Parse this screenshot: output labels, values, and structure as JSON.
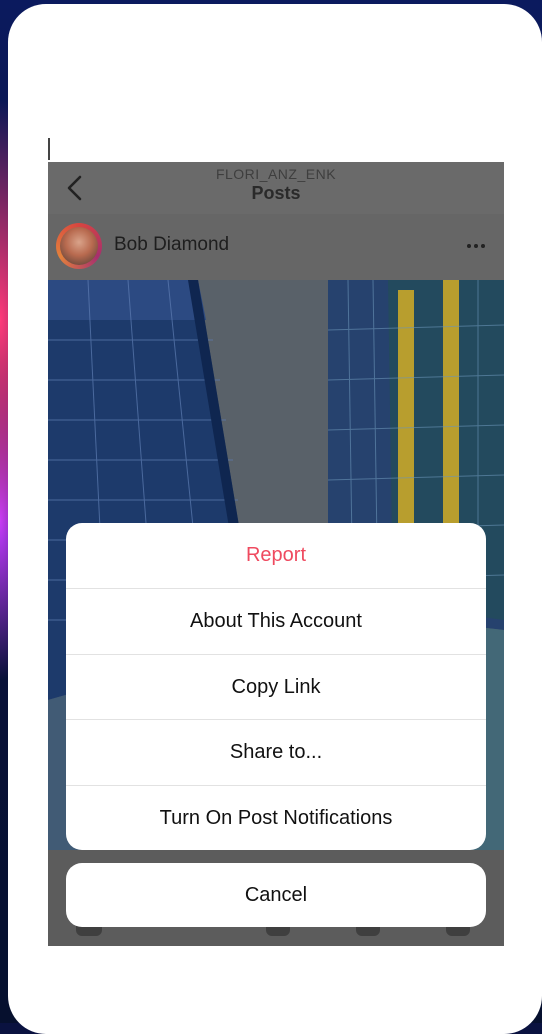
{
  "header": {
    "account_handle": "FLORI_ANZ_ENK",
    "title": "Posts"
  },
  "post": {
    "author": "Bob Diamond",
    "more_icon": "ellipsis-icon",
    "back_icon": "chevron-left-icon"
  },
  "action_sheet": {
    "items": [
      {
        "label": "Report",
        "color": "#ef4a5f"
      },
      {
        "label": "About This Account"
      },
      {
        "label": "Copy Link"
      },
      {
        "label": "Share to..."
      },
      {
        "label": "Turn On Post Notifications"
      }
    ],
    "cancel_label": "Cancel"
  }
}
